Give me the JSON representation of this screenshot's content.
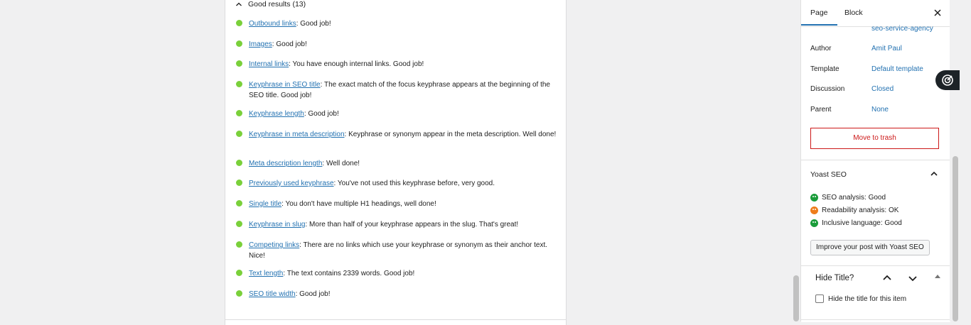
{
  "good_results": {
    "header": "Good results (13)",
    "items": [
      {
        "link": "Outbound links",
        "text": ": Good job!"
      },
      {
        "link": "Images",
        "text": ": Good job!"
      },
      {
        "link": "Internal links",
        "text": ": You have enough internal links. Good job!"
      },
      {
        "link": "Keyphrase in SEO title",
        "text": ": The exact match of the focus keyphrase appears at the beginning of the SEO title. Good job!"
      },
      {
        "link": "Keyphrase length",
        "text": ": Good job!"
      },
      {
        "link": "Keyphrase in meta description",
        "text": ": Keyphrase or synonym appear in the meta description. Well done!"
      },
      {
        "link": "Meta description length",
        "text": ": Well done!"
      },
      {
        "link": "Previously used keyphrase",
        "text": ": You've not used this keyphrase before, very good."
      },
      {
        "link": "Single title",
        "text": ": You don't have multiple H1 headings, well done!"
      },
      {
        "link": "Keyphrase in slug",
        "text": ": More than half of your keyphrase appears in the slug. That's great!"
      },
      {
        "link": "Competing links",
        "text": ": There are no links which use your keyphrase or synonym as their anchor text. Nice!"
      },
      {
        "link": "Text length",
        "text": ": The text contains 2339 words. Good job!"
      },
      {
        "link": "SEO title width",
        "text": ": Good job!"
      }
    ]
  },
  "sidebar": {
    "tabs": [
      "Page",
      "Block"
    ],
    "slug_value": "seo-service-agency",
    "author_label": "Author",
    "author_value": "Amit Paul",
    "template_label": "Template",
    "template_value": "Default template",
    "discussion_label": "Discussion",
    "discussion_value": "Closed",
    "parent_label": "Parent",
    "parent_value": "None",
    "trash_label": "Move to trash",
    "yoast_title": "Yoast SEO",
    "seo_label": "SEO analysis:",
    "seo_value": "Good",
    "readability_label": "Readability analysis:",
    "readability_value": "OK",
    "inclusive_label": "Inclusive language:",
    "inclusive_value": "Good",
    "improve_label": "Improve your post with Yoast SEO",
    "hide_title_heading": "Hide Title?",
    "hide_title_checkbox_label": "Hide the title for this item"
  },
  "colors": {
    "good": "#7ad03a",
    "ok": "#ee7c1b",
    "link": "#2271b1",
    "danger": "#cc1818"
  }
}
